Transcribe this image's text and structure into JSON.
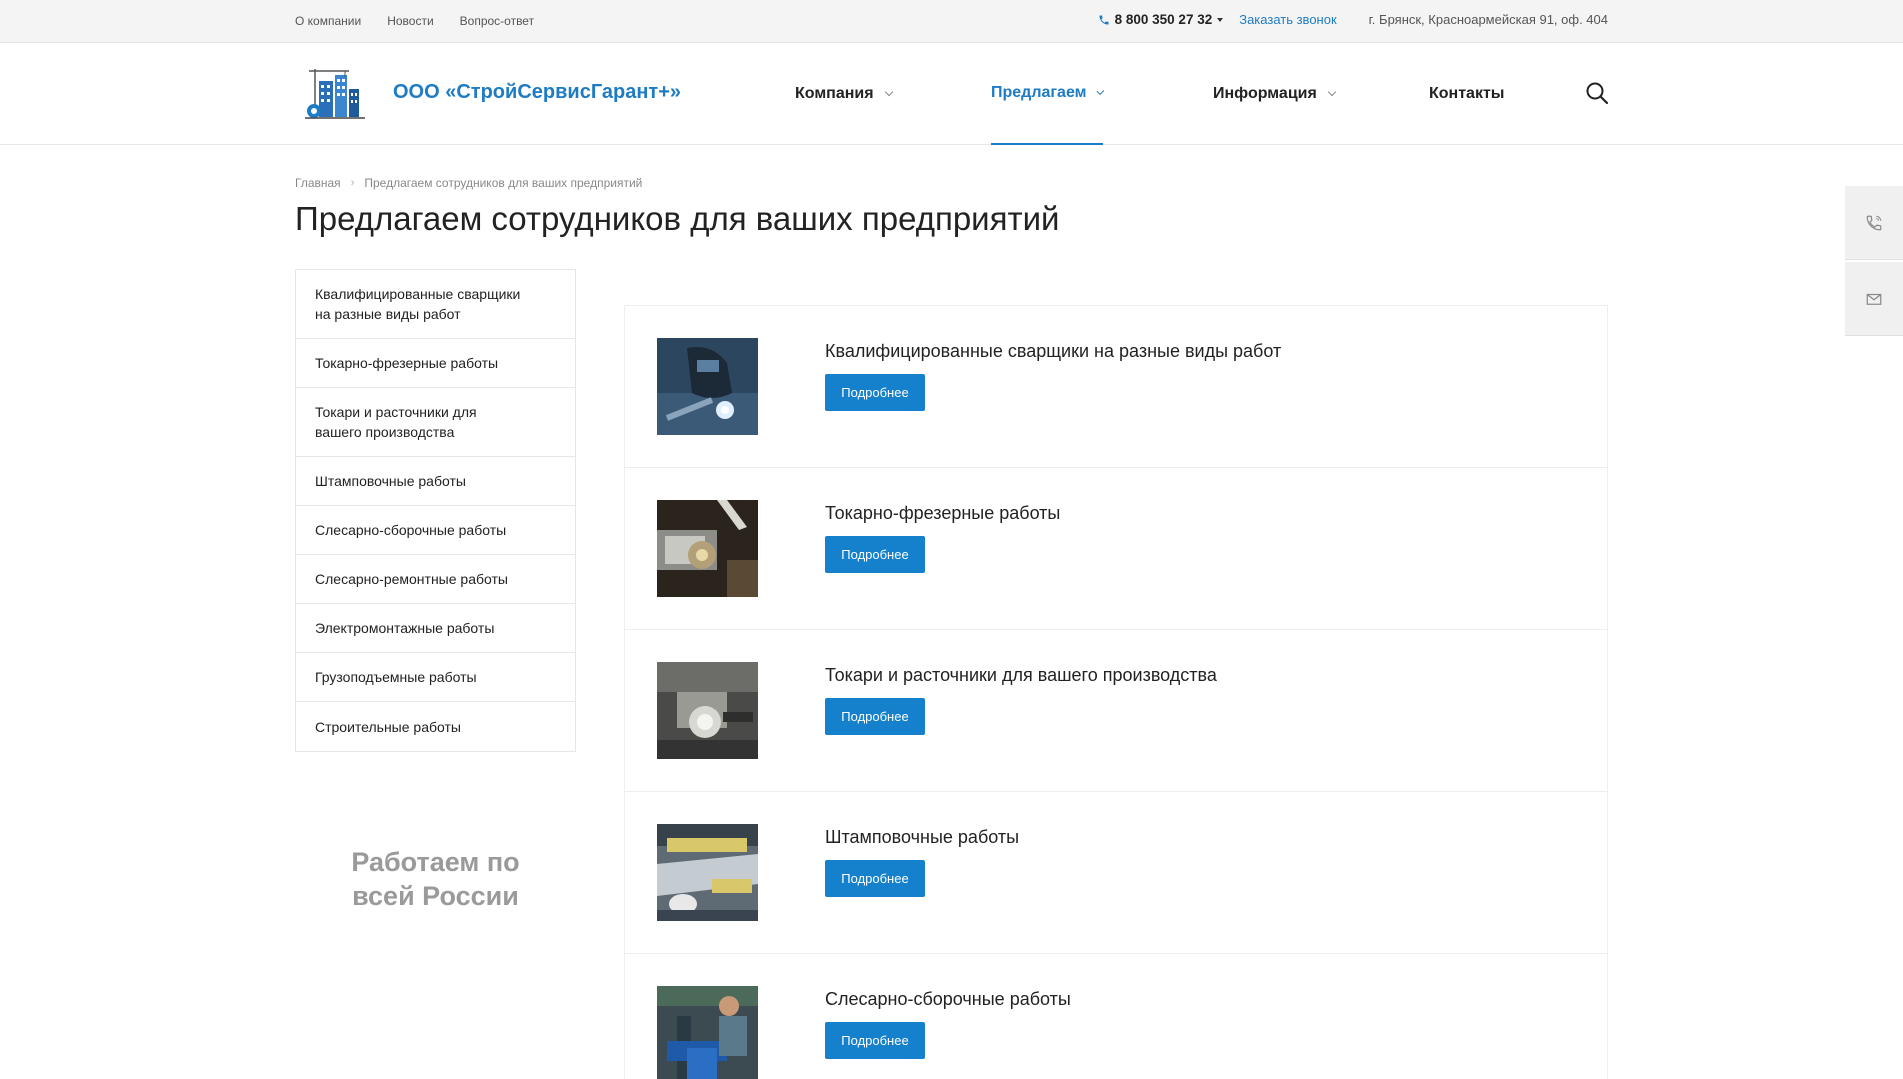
{
  "topbar": {
    "links": [
      "О компании",
      "Новости",
      "Вопрос-ответ"
    ],
    "phone": "8 800 350 27 32",
    "callback": "Заказать звонок",
    "address": "г. Брянск, Красноармейская 91, оф. 404"
  },
  "header": {
    "logo_text": "ООО «СтройСервисГарант+»",
    "nav": [
      {
        "label": "Компания",
        "has_dropdown": true,
        "active": false
      },
      {
        "label": "Предлагаем",
        "has_dropdown": true,
        "active": true
      },
      {
        "label": "Информация",
        "has_dropdown": true,
        "active": false
      },
      {
        "label": "Контакты",
        "has_dropdown": false,
        "active": false
      }
    ]
  },
  "breadcrumb": {
    "home": "Главная",
    "current": "Предлагаем сотрудников для ваших предприятий"
  },
  "page_title": "Предлагаем сотрудников для ваших предприятий",
  "sidebar": {
    "items": [
      "Квалифицированные сварщики на разные виды работ",
      "Токарно-фрезерные работы",
      "Токари и расточники для вашего производства",
      "Штамповочные работы",
      "Слесарно-сборочные работы",
      "Слесарно-ремонтные работы",
      "Электромонтажные работы",
      "Грузоподъемные работы",
      "Строительные работы"
    ],
    "promo": "Работаем по всей России"
  },
  "services": [
    {
      "title": "Квалифицированные сварщики на разные виды работ",
      "button": "Подробнее"
    },
    {
      "title": "Токарно-фрезерные работы",
      "button": "Подробнее"
    },
    {
      "title": "Токари и расточники для вашего производства",
      "button": "Подробнее"
    },
    {
      "title": "Штамповочные работы",
      "button": "Подробнее"
    },
    {
      "title": "Слесарно-сборочные работы",
      "button": "Подробнее"
    }
  ],
  "colors": {
    "accent": "#1e7cc4",
    "button": "#1580cc",
    "promo_text": "#9a9a9a"
  }
}
